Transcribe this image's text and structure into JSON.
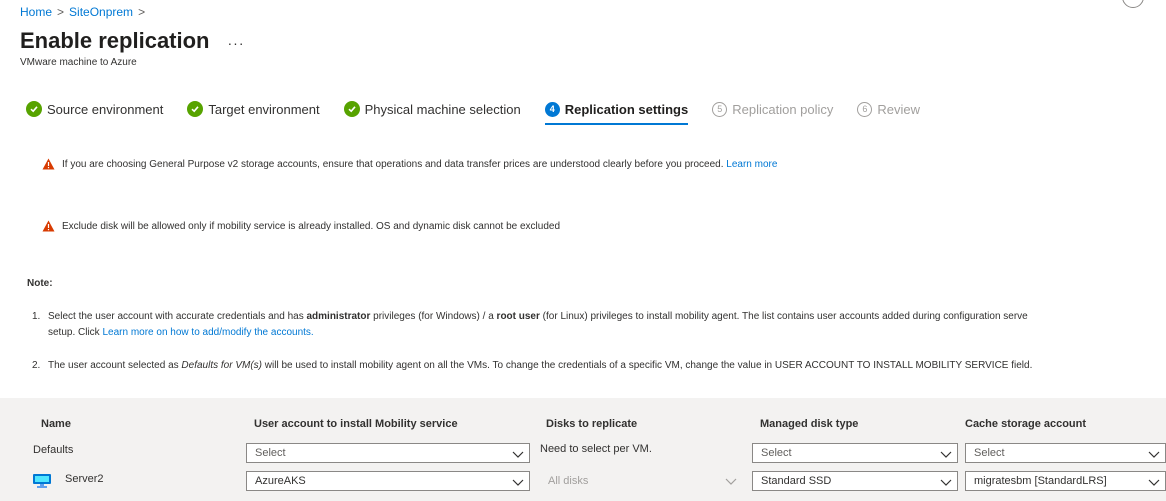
{
  "breadcrumb": {
    "home": "Home",
    "sep1": ">",
    "item": "SiteOnprem",
    "sep2": ">"
  },
  "header": {
    "title": "Enable replication",
    "more": "···",
    "subtitle": "VMware machine to Azure"
  },
  "steps": [
    {
      "label": "Source environment",
      "state": "complete"
    },
    {
      "label": "Target environment",
      "state": "complete"
    },
    {
      "label": "Physical machine selection",
      "state": "complete"
    },
    {
      "label": "Replication settings",
      "state": "active",
      "number": "4"
    },
    {
      "label": "Replication policy",
      "state": "disabled",
      "number": "5"
    },
    {
      "label": "Review",
      "state": "disabled",
      "number": "6"
    }
  ],
  "warnings": {
    "storage": {
      "text": "If you are choosing General Purpose v2 storage accounts, ensure that operations and data transfer prices are understood clearly before you proceed.",
      "link": "Learn more"
    },
    "exclude": {
      "text": "Exclude disk will be allowed only if mobility service is already installed. OS and dynamic disk cannot be excluded"
    }
  },
  "note": {
    "label": "Note:",
    "item1": {
      "num": "1.",
      "t1": "Select the user account with accurate credentials and has ",
      "b1": "administrator",
      "t2": " privileges (for Windows) / a ",
      "b2": "root user",
      "t3": " (for Linux) privileges to install mobility agent. The list contains user accounts added during configuration serve",
      "line2_pre": "setup. Click ",
      "line2_link": "Learn more on how to add/modify the accounts."
    },
    "item2": {
      "num": "2.",
      "t1": "The user account selected as ",
      "i1": "Defaults for VM(s)",
      "t2": " will be used to install mobility agent on all the VMs. To change the credentials of a specific VM, change the value in USER ACCOUNT TO INSTALL MOBILITY SERVICE field."
    }
  },
  "table": {
    "headers": {
      "name": "Name",
      "user_account": "User account to install Mobility service",
      "disks": "Disks to replicate",
      "managed_disk": "Managed disk type",
      "cache": "Cache storage account"
    },
    "defaults_row": {
      "name": "Defaults",
      "user_account": "Select",
      "disks": "Need to select per VM.",
      "managed_disk": "Select",
      "cache": "Select"
    },
    "server_row": {
      "name": "Server2",
      "user_account": "AzureAKS",
      "disks": "All disks",
      "managed_disk": "Standard SSD",
      "cache": "migratesbm [StandardLRS]"
    }
  },
  "colors": {
    "accent": "#0078d4",
    "success": "#57a300",
    "warning": "#d83b01",
    "grid_bg": "#f3f2f1"
  }
}
